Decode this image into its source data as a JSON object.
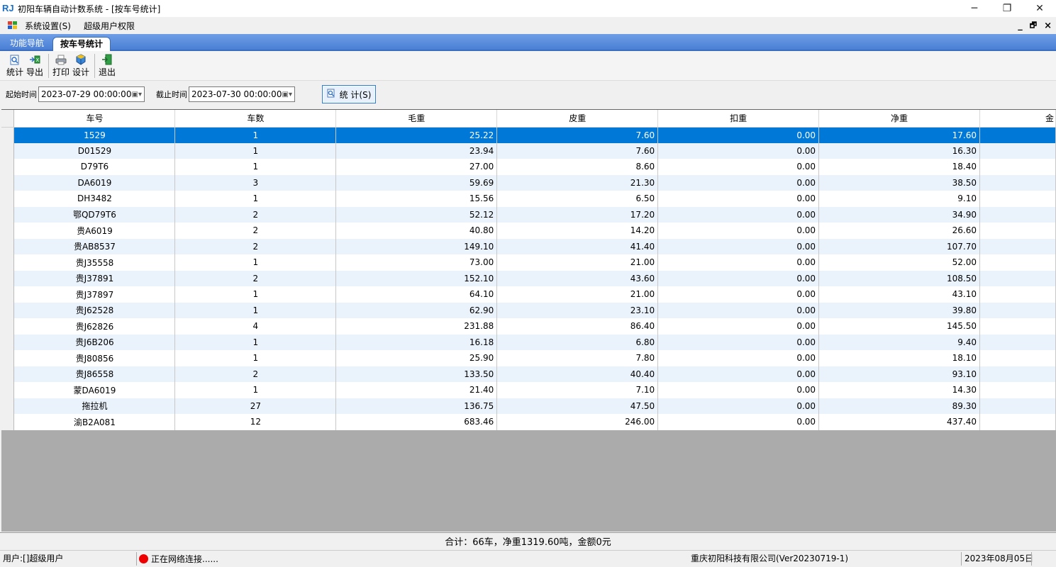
{
  "window": {
    "title": "初阳车辆自动计数系统 - [按车号统计]",
    "logo": "RJ",
    "minimize": "─",
    "restore": "❐",
    "close": "✕"
  },
  "menu": {
    "items": [
      "系统设置(S)",
      "超级用户权限"
    ],
    "mdi_minimize": "_",
    "mdi_restore": "🗗",
    "mdi_close": "×"
  },
  "tabs": {
    "nav": "功能导航",
    "active": "按车号统计"
  },
  "toolbar": {
    "stat": "统计",
    "export": "导出",
    "print": "打印",
    "design": "设计",
    "exit": "退出"
  },
  "filter": {
    "start_label": "起始时间",
    "start_value": "2023-07-29 00:00:00",
    "end_label": "截止时间",
    "end_value": "2023-07-30 00:00:00",
    "stat_button": "统 计(S)"
  },
  "grid": {
    "columns": [
      "车号",
      "车数",
      "毛重",
      "皮重",
      "扣重",
      "净重",
      "金"
    ],
    "rows": [
      [
        "1529",
        "1",
        "25.22",
        "7.60",
        "0.00",
        "17.60",
        ""
      ],
      [
        "D01529",
        "1",
        "23.94",
        "7.60",
        "0.00",
        "16.30",
        ""
      ],
      [
        "D79T6",
        "1",
        "27.00",
        "8.60",
        "0.00",
        "18.40",
        ""
      ],
      [
        "DA6019",
        "3",
        "59.69",
        "21.30",
        "0.00",
        "38.50",
        ""
      ],
      [
        "DH3482",
        "1",
        "15.56",
        "6.50",
        "0.00",
        "9.10",
        ""
      ],
      [
        "鄂QD79T6",
        "2",
        "52.12",
        "17.20",
        "0.00",
        "34.90",
        ""
      ],
      [
        "贵A6019",
        "2",
        "40.80",
        "14.20",
        "0.00",
        "26.60",
        ""
      ],
      [
        "贵AB8537",
        "2",
        "149.10",
        "41.40",
        "0.00",
        "107.70",
        ""
      ],
      [
        "贵J35558",
        "1",
        "73.00",
        "21.00",
        "0.00",
        "52.00",
        ""
      ],
      [
        "贵J37891",
        "2",
        "152.10",
        "43.60",
        "0.00",
        "108.50",
        ""
      ],
      [
        "贵J37897",
        "1",
        "64.10",
        "21.00",
        "0.00",
        "43.10",
        ""
      ],
      [
        "贵J62528",
        "1",
        "62.90",
        "23.10",
        "0.00",
        "39.80",
        ""
      ],
      [
        "贵J62826",
        "4",
        "231.88",
        "86.40",
        "0.00",
        "145.50",
        ""
      ],
      [
        "贵J6B206",
        "1",
        "16.18",
        "6.80",
        "0.00",
        "9.40",
        ""
      ],
      [
        "贵J80856",
        "1",
        "25.90",
        "7.80",
        "0.00",
        "18.10",
        ""
      ],
      [
        "贵J86558",
        "2",
        "133.50",
        "40.40",
        "0.00",
        "93.10",
        ""
      ],
      [
        "蒙DA6019",
        "1",
        "21.40",
        "7.10",
        "0.00",
        "14.30",
        ""
      ],
      [
        "拖拉机",
        "27",
        "136.75",
        "47.50",
        "0.00",
        "89.30",
        ""
      ],
      [
        "渝B2A081",
        "12",
        "683.46",
        "246.00",
        "0.00",
        "437.40",
        ""
      ]
    ],
    "selected_row": 0
  },
  "summary": "合计：66车，净重1319.60吨，金额0元",
  "status": {
    "user": "用户:[]超级用户",
    "network": "正在网络连接......",
    "company": "重庆初阳科技有限公司(Ver20230719-1)",
    "date": "2023年08月05日"
  },
  "colors": {
    "selection": "#0078d7",
    "tab_strip": "#4a7fd4",
    "alt_row": "#eaf2fb",
    "status_dot": "#ee0000"
  }
}
